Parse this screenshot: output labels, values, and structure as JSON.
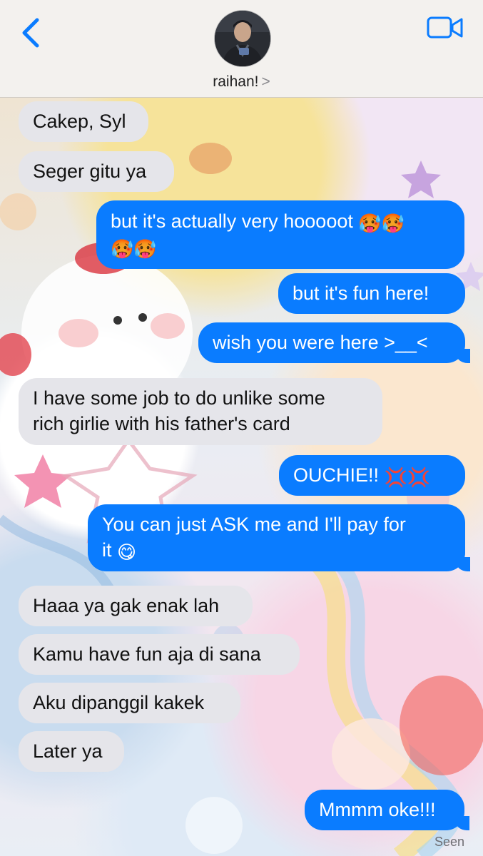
{
  "header": {
    "contact_name": "raihan!",
    "chevron": ">",
    "back_icon": "chevron-left-icon",
    "video_icon": "video-camera-icon",
    "accent": "#0a7cff"
  },
  "messages": [
    {
      "from": "them",
      "text": "Cakep, Syl"
    },
    {
      "from": "them",
      "text": "Seger gitu ya"
    },
    {
      "from": "me",
      "line1": "but it's actually very hooooot",
      "line2": "",
      "emoji": [
        "hot-face",
        "hot-face",
        "hot-face",
        "hot-face"
      ]
    },
    {
      "from": "me",
      "text": "but it's fun here!"
    },
    {
      "from": "me",
      "text": "wish you were here >__<"
    },
    {
      "from": "them",
      "line1": "I have some job to do unlike some",
      "line2": "rich girlie with his father's card"
    },
    {
      "from": "me",
      "text": "OUCHIE!!",
      "emoji": [
        "anger-symbol",
        "anger-symbol"
      ]
    },
    {
      "from": "me",
      "line1": "You can just ASK me and I'll pay for",
      "line2": "it",
      "emoji": [
        "yum-face"
      ]
    },
    {
      "from": "them",
      "text": "Haaa ya gak enak lah"
    },
    {
      "from": "them",
      "text": "Kamu have fun aja di sana"
    },
    {
      "from": "them",
      "text": "Aku dipanggil kakek"
    },
    {
      "from": "them",
      "text": "Later ya"
    },
    {
      "from": "me",
      "text": "Mmmm oke!!!"
    }
  ],
  "status": {
    "seen": "Seen"
  }
}
